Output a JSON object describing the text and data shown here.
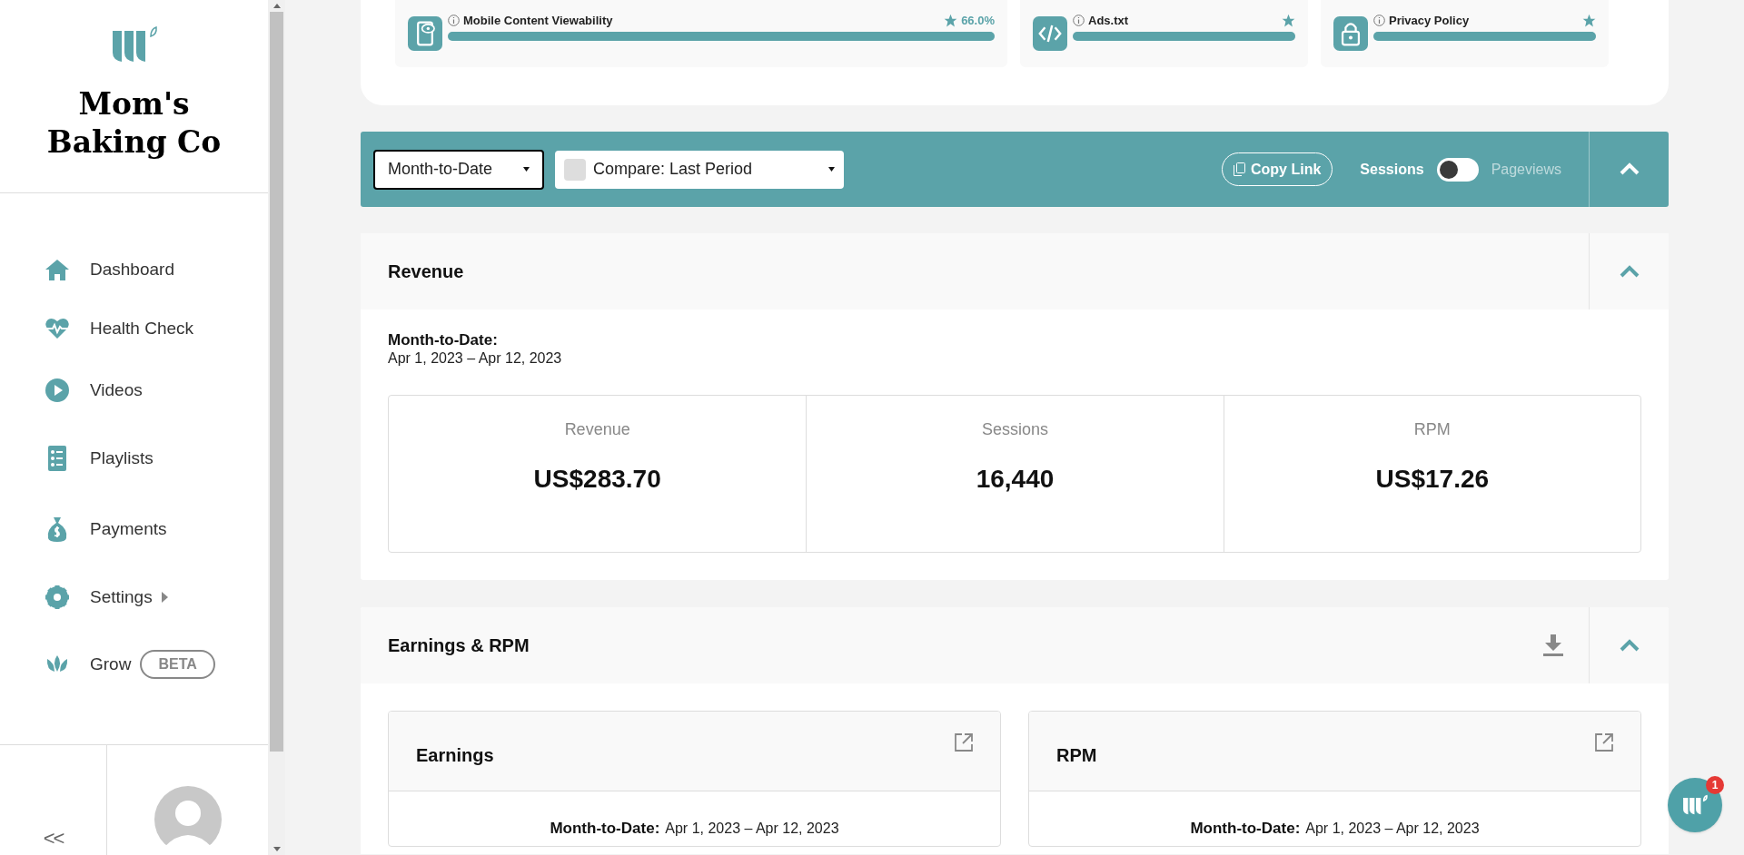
{
  "sidebar": {
    "brand": "Mom's Baking Co",
    "items": [
      {
        "label": "Dashboard",
        "submenu": false
      },
      {
        "label": "Health Check",
        "submenu": false
      },
      {
        "label": "Videos",
        "submenu": false
      },
      {
        "label": "Playlists",
        "submenu": false
      },
      {
        "label": "Payments",
        "submenu": false
      },
      {
        "label": "Settings",
        "submenu": true
      },
      {
        "label": "Grow",
        "submenu": false,
        "badge": "BETA"
      }
    ],
    "collapse": "<<"
  },
  "health_checks": [
    {
      "label": "Mobile Content Viewability",
      "score": "66.0%",
      "level": 1
    },
    {
      "label": "Ads.txt",
      "level": 1
    },
    {
      "label": "Privacy Policy",
      "level": 1
    }
  ],
  "filter_bar": {
    "range": "Month-to-Date",
    "compare": "Compare: Last Period",
    "copy_link": "Copy Link",
    "toggle": {
      "left": "Sessions",
      "right": "Pageviews",
      "on": false
    }
  },
  "revenue": {
    "title": "Revenue",
    "period_label": "Month-to-Date:",
    "period": "Apr 1, 2023 – Apr 12, 2023",
    "metrics": [
      {
        "label": "Revenue",
        "value": "US$283.70"
      },
      {
        "label": "Sessions",
        "value": "16,440"
      },
      {
        "label": "RPM",
        "value": "US$17.26"
      }
    ]
  },
  "earnings_rpm": {
    "title": "Earnings & RPM",
    "cards": [
      {
        "title": "Earnings",
        "period_label": "Month-to-Date:",
        "period": "Apr 1, 2023 – Apr 12, 2023"
      },
      {
        "title": "RPM",
        "period_label": "Month-to-Date:",
        "period": "Apr 1, 2023 – Apr 12, 2023"
      }
    ]
  },
  "chat": {
    "badge": "1"
  }
}
